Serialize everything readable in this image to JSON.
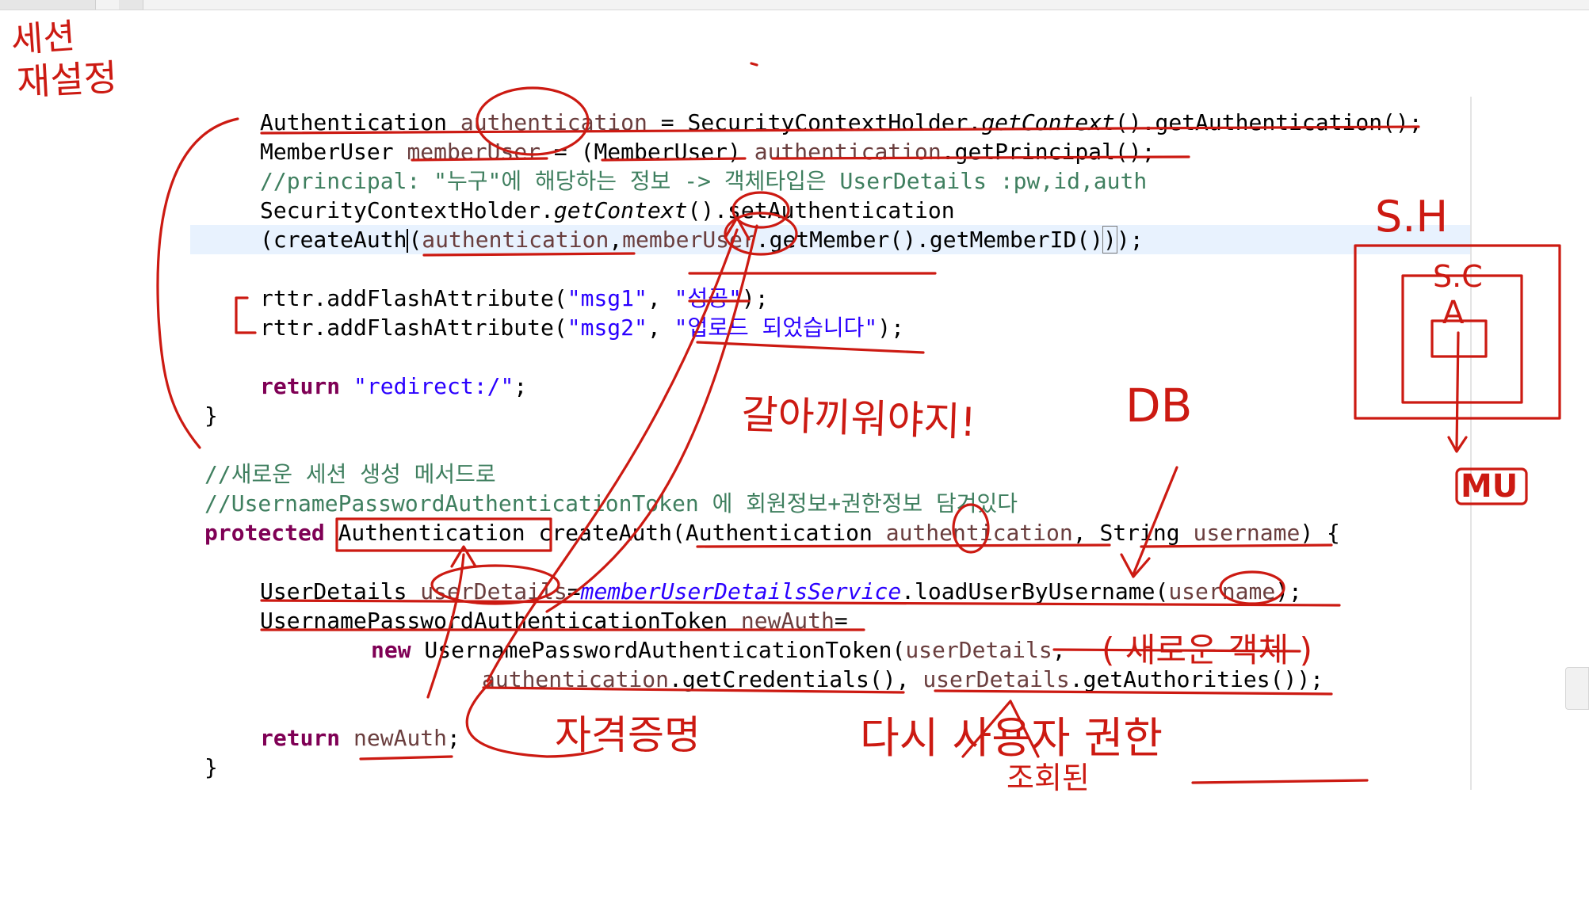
{
  "code": {
    "l1": {
      "a": "Authentication ",
      "b": "authentication",
      "c": " = SecurityContextHolder.",
      "d": "getContext",
      "e": "().getAuthentication();"
    },
    "l2": {
      "a": "MemberUser ",
      "b": "memberUser",
      "c": " = (MemberUser) ",
      "d": "authentication",
      "e": ".getPrincipal();"
    },
    "l3": "//principal: \"누구\"에 해당하는 정보 -> 객체타입은 UserDetails :pw,id,auth",
    "l4": {
      "a": "SecurityContextHolder.",
      "b": "getContext",
      "c": "().setAuthentication"
    },
    "l5": {
      "a": "(createAuth",
      "b": "(",
      "c": "authentication",
      "d": ",",
      "e": "memberUser",
      "f": ".getMember().getMemberID()",
      "g": ")",
      "h": ");"
    },
    "l6": {
      "a": "rttr.addFlashAttribute(",
      "b": "\"msg1\"",
      "c": ", ",
      "d": "\"성공\"",
      "e": ");"
    },
    "l7": {
      "a": "rttr.addFlashAttribute(",
      "b": "\"msg2\"",
      "c": ", ",
      "d": "\"업로드 되었습니다\"",
      "e": ");"
    },
    "l8": {
      "a": "return",
      "b": " ",
      "c": "\"redirect:/\"",
      "d": ";"
    },
    "l9": "}",
    "l10": "//새로운 세션 생성 메서드로",
    "l11": "//UsernamePasswordAuthenticationToken 에 회원정보+권한정보 담겨있다",
    "l12": {
      "a": "protected",
      "b": " Authentication createAuth(Authentication ",
      "c": "authentication",
      "d": ", String ",
      "e": "username",
      "f": ") {"
    },
    "l13": {
      "a": "UserDetails ",
      "b": "userDetails",
      "c": "=",
      "d": "memberUserDetailsService",
      "e": ".loadUserByUsername(",
      "f": "username",
      "g": ");"
    },
    "l14": {
      "a": "UsernamePasswordAuthenticationToken ",
      "b": "newAuth",
      "c": "="
    },
    "l15": {
      "a": "new",
      "b": " UsernamePasswordAuthenticationToken(",
      "c": "userDetails",
      "d": ","
    },
    "l16": {
      "a": "authentication",
      "b": ".getCredentials(), ",
      "c": "userDetails",
      "d": ".getAuthorities());"
    },
    "l17": {
      "a": "return",
      "b": " ",
      "c": "newAuth",
      "d": ";"
    },
    "l18": "}"
  },
  "handwriting": {
    "session_title_1": "세션",
    "session_title_2": "재설정",
    "swap": "갈아끼워야지!",
    "db": "DB",
    "sh": "S.H",
    "sc": "S.C",
    "a": "A",
    "mu": "MU",
    "credential": "자격증명",
    "new_object": "( 새로운 객체 )",
    "again": "다시 사용자 권한",
    "retrieve": "조회된"
  },
  "colors": {
    "ink": "#cc1a12",
    "keyword": "#7f0055",
    "string": "#2a00ff",
    "comment": "#3f7f5f",
    "field": "#6a3e3e"
  }
}
